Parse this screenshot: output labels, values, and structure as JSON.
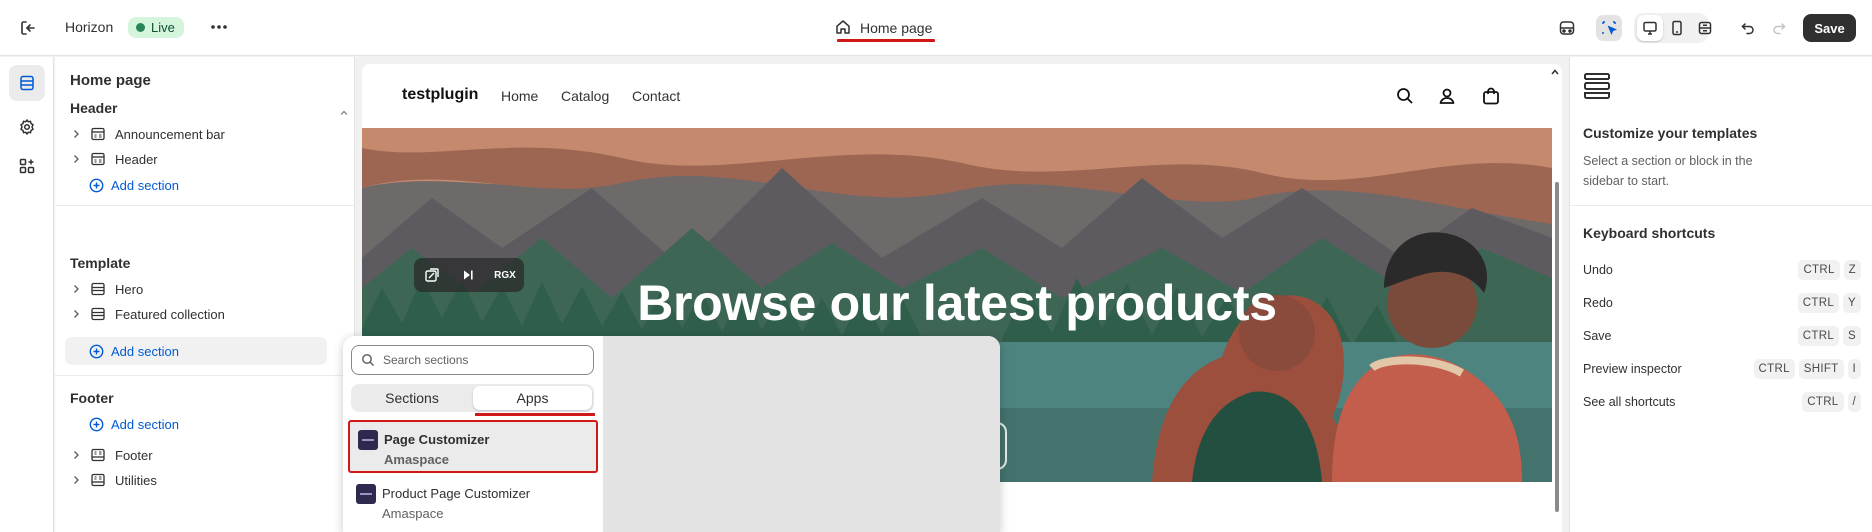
{
  "topbar": {
    "store_name": "Horizon",
    "live_badge": "Live",
    "page_selector": "Home page",
    "save_label": "Save"
  },
  "sidebar": {
    "title": "Home page",
    "groups": [
      {
        "title": "Header",
        "items": [
          "Announcement bar",
          "Header"
        ],
        "add_label": "Add section"
      },
      {
        "title": "Template",
        "items": [
          "Hero",
          "Featured collection"
        ],
        "add_label": "Add section"
      },
      {
        "title": "Footer",
        "add_label": "Add section",
        "items": [
          "Footer",
          "Utilities"
        ]
      }
    ]
  },
  "preview": {
    "brand": "testplugin",
    "nav": [
      "Home",
      "Catalog",
      "Contact"
    ],
    "hero_title": "Browse our latest products",
    "hero_tool_label": "RGX"
  },
  "popover": {
    "search_placeholder": "Search sections",
    "tabs": [
      "Sections",
      "Apps"
    ],
    "active_tab": "Apps",
    "apps": [
      {
        "name": "Page Customizer",
        "vendor": "Amaspace",
        "selected": true
      },
      {
        "name": "Product Page Customizer",
        "vendor": "Amaspace",
        "selected": false
      }
    ]
  },
  "right_panel": {
    "title": "Customize your templates",
    "description": "Select a section or block in the sidebar to start.",
    "shortcuts_title": "Keyboard shortcuts",
    "shortcuts": [
      {
        "label": "Undo",
        "keys": [
          "CTRL",
          "Z"
        ]
      },
      {
        "label": "Redo",
        "keys": [
          "CTRL",
          "Y"
        ]
      },
      {
        "label": "Save",
        "keys": [
          "CTRL",
          "S"
        ]
      },
      {
        "label": "Preview inspector",
        "keys": [
          "CTRL",
          "SHIFT",
          "I"
        ]
      },
      {
        "label": "See all shortcuts",
        "keys": [
          "CTRL",
          "/"
        ]
      }
    ]
  },
  "colors": {
    "accent_blue": "#005bd3",
    "live_green": "#29845a",
    "highlight_red": "#d01818",
    "primary_dark": "#303030"
  }
}
